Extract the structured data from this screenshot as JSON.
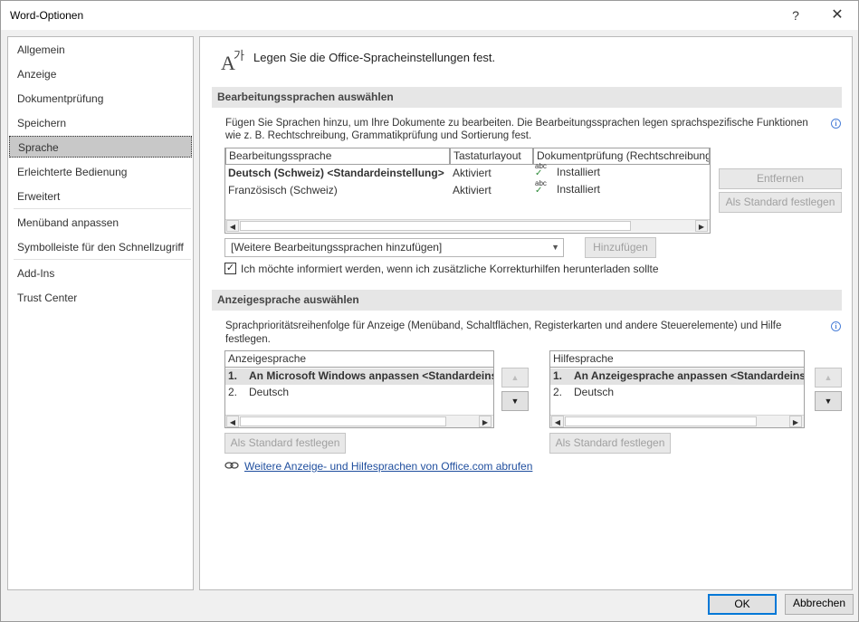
{
  "window": {
    "title": "Word-Optionen",
    "help_glyph": "?",
    "close_glyph": "✕"
  },
  "sidebar": {
    "items": [
      {
        "label": "Allgemein"
      },
      {
        "label": "Anzeige"
      },
      {
        "label": "Dokumentprüfung"
      },
      {
        "label": "Speichern"
      },
      {
        "label": "Sprache",
        "selected": true
      },
      {
        "label": "Erleichterte Bedienung"
      },
      {
        "label": "Erweitert"
      },
      {
        "label": "Menüband anpassen"
      },
      {
        "label": "Symbolleiste für den Schnellzugriff"
      },
      {
        "label": "Add-Ins"
      },
      {
        "label": "Trust Center"
      }
    ]
  },
  "header": {
    "text": "Legen Sie die Office-Spracheinstellungen fest.",
    "icon": "language-icon"
  },
  "editing": {
    "section_title": "Bearbeitungssprachen auswählen",
    "description": "Fügen Sie Sprachen hinzu, um Ihre Dokumente zu bearbeiten. Die Bearbeitungssprachen legen sprachspezifische Funktionen wie z. B. Rechtschreibung, Grammatikprüfung und Sortierung fest.",
    "columns": [
      "Bearbeitungssprache",
      "Tastaturlayout",
      "Dokumentprüfung (Rechtschreibung"
    ],
    "rows": [
      {
        "language": "Deutsch (Schweiz) <Standardeinstellung>",
        "keyboard": "Aktiviert",
        "proofing_icon": "abc",
        "proofing": "Installiert",
        "bold": true
      },
      {
        "language": "Französisch (Schweiz)",
        "keyboard": "Aktiviert",
        "proofing_icon": "abc",
        "proofing": "Installiert",
        "bold": false
      }
    ],
    "remove_button": "Entfernen",
    "set_default_button": "Als Standard festlegen",
    "add_dropdown": "[Weitere Bearbeitungssprachen hinzufügen]",
    "add_button": "Hinzufügen",
    "notify_checkbox": {
      "checked": true,
      "label": "Ich möchte informiert werden, wenn ich zusätzliche Korrekturhilfen herunterladen sollte"
    }
  },
  "display": {
    "section_title": "Anzeigesprache auswählen",
    "description_line1": "Sprachprioritätsreihenfolge für Anzeige (Menüband, Schaltflächen, Registerkarten und andere Steuerelemente) und Hilfe",
    "description_line2": "festlegen.",
    "display_list": {
      "header": "Anzeigesprache",
      "items": [
        {
          "num": "1.",
          "label": "An Microsoft Windows anpassen <Standardeinste",
          "bold": true
        },
        {
          "num": "2.",
          "label": "Deutsch",
          "bold": false
        }
      ],
      "set_default_button": "Als Standard festlegen"
    },
    "help_list": {
      "header": "Hilfesprache",
      "items": [
        {
          "num": "1.",
          "label": "An Anzeigesprache anpassen <Standardeinste",
          "bold": true
        },
        {
          "num": "2.",
          "label": "Deutsch",
          "bold": false
        }
      ],
      "set_default_button": "Als Standard festlegen"
    },
    "link": "Weitere Anzeige- und Hilfesprachen von Office.com abrufen"
  },
  "footer": {
    "ok": "OK",
    "cancel": "Abbrechen"
  },
  "colors": {
    "accent": "#0078d7",
    "link": "#1f4e9e",
    "check": "#2e8b3a",
    "info": "#4a7fd8"
  }
}
